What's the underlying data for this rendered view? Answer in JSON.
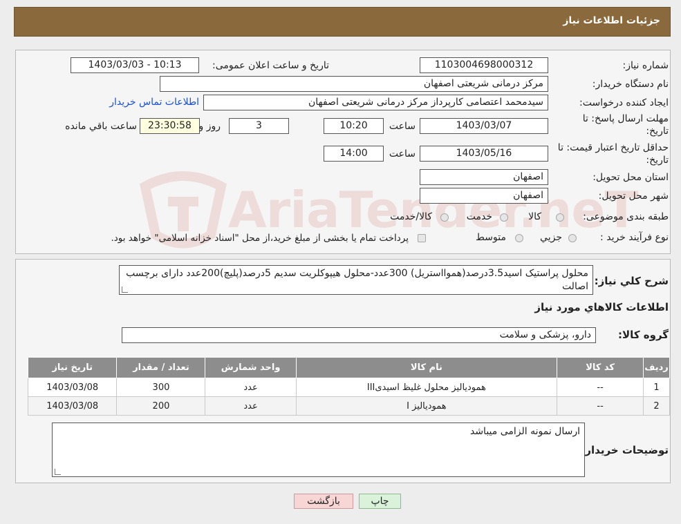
{
  "header": {
    "title": "جزئیات اطلاعات نیاز"
  },
  "form": {
    "need_number_label": "شماره نیاز:",
    "need_number": "1103004698000312",
    "announce_label": "تاریخ و ساعت اعلان عمومی:",
    "announce_value": "1403/03/03 - 10:13",
    "buyer_org_label": "نام دستگاه خریدار:",
    "buyer_org": "مرکز درمانی شریعتی اصفهان",
    "creator_label": "ایجاد کننده درخواست:",
    "creator": "سیدمحمد اعتصامی کارپرداز مرکز درمانی شریعتی اصفهان",
    "contact_link": "اطلاعات تماس خریدار",
    "deadline_label_1": "مهلت ارسال پاسخ: تا",
    "deadline_label_2": "تاریخ:",
    "deadline_date": "1403/03/07",
    "time_label": "ساعت",
    "deadline_time": "10:20",
    "days_value": "3",
    "days_label": "روز و",
    "remaining_time": "23:30:58",
    "remaining_label": "ساعت باقي مانده",
    "validity_label_1": "حداقل تاریخ اعتبار قیمت: تا",
    "validity_label_2": "تاریخ:",
    "validity_date": "1403/05/16",
    "validity_time": "14:00",
    "province_label": "استان محل تحویل:",
    "province": "اصفهان",
    "city_label": "شهر محل تحویل:",
    "city": "اصفهان",
    "category_label": "طبقه بندی موضوعی:",
    "category_options": [
      "کالا",
      "خدمت",
      "کالا/خدمت"
    ],
    "process_label": "نوع فرآیند خرید :",
    "process_options": [
      "جزيي",
      "متوسط"
    ],
    "process_note": "پرداخت تمام یا بخشی از مبلغ خرید،از محل \"اسناد خزانه اسلامی\" خواهد بود."
  },
  "details": {
    "description_label": "شرح کلي نياز:",
    "description": "محلول پراستیک اسید3.5درصد(هموااستریل) 300عدد-محلول هیپوکلریت سدیم 5درصد(پلیچ)200عدد دارای برچسب اصالت",
    "items_title": "اطلاعات کالاهاي مورد نياز",
    "group_label": "گروه کالا:",
    "group_value": "دارو، پزشکی و سلامت",
    "table": {
      "headers": [
        "رديف",
        "کد کالا",
        "نام کالا",
        "واحد شمارش",
        "تعداد / مقدار",
        "تاريخ نياز"
      ],
      "rows": [
        [
          "1",
          "--",
          "همودیالیز محلول غلیظ اسیدیIII",
          "عدد",
          "300",
          "1403/03/08"
        ],
        [
          "2",
          "--",
          "همودیالیز I",
          "عدد",
          "200",
          "1403/03/08"
        ]
      ]
    },
    "buyer_notes_label": "توضیحات خریدار:",
    "buyer_notes": "ارسال نمونه الزامی میباشد"
  },
  "buttons": {
    "print": "چاپ",
    "back": "بازگشت"
  },
  "watermark": {
    "text": "AriaTender.neT"
  },
  "colors": {
    "header": "#8a6a3c",
    "link": "#1a4fd6",
    "table_header": "#8d8d8d",
    "back_button": "#f8d6d6",
    "print_button": "#d9f2d9"
  }
}
